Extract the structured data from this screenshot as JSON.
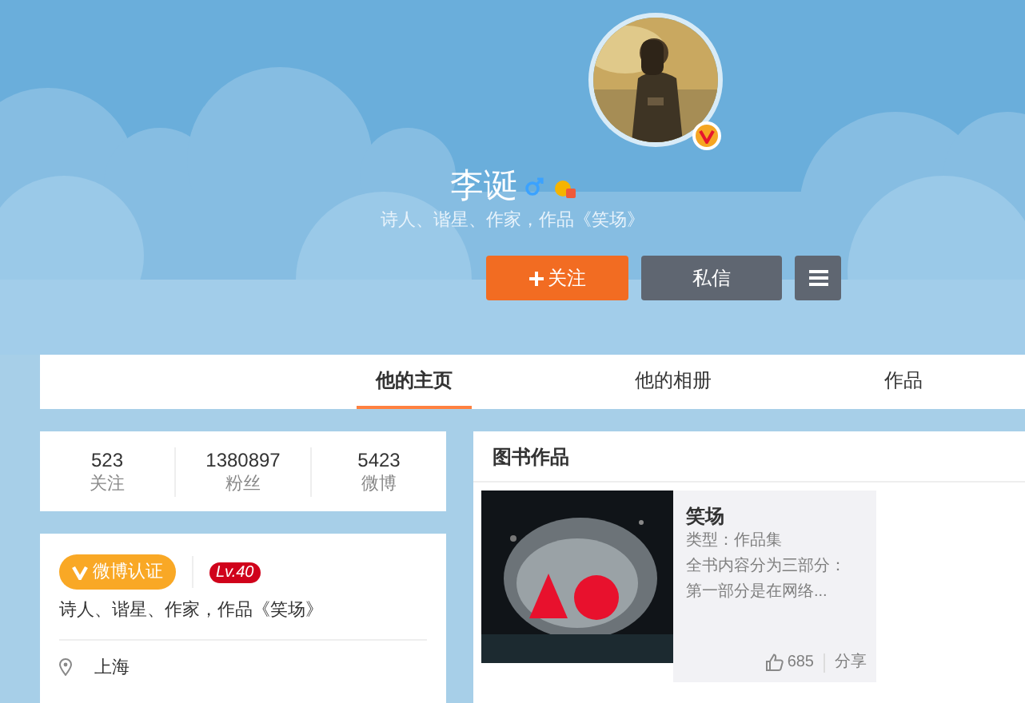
{
  "profile": {
    "name": "李诞",
    "bio": "诗人、谐星、作家，作品《笑场》",
    "verified": true
  },
  "actions": [
    {
      "kind": "follow",
      "label": "关注"
    },
    {
      "kind": "message",
      "label": "私信"
    },
    {
      "kind": "menu"
    }
  ],
  "tabs": [
    {
      "label": "他的主页",
      "selected": true
    },
    {
      "label": "他的相册",
      "selected": false
    },
    {
      "label": "作品",
      "selected": false
    }
  ],
  "stats": [
    {
      "value": "523",
      "label": "关注"
    },
    {
      "value": "1380897",
      "label": "粉丝"
    },
    {
      "value": "5423",
      "label": "微博"
    }
  ],
  "info": {
    "badge": "微博认证",
    "level": "Lv.40",
    "bio": "诗人、谐星、作家，作品《笑场》",
    "location": "上海"
  },
  "books_section": {
    "title": "图书作品",
    "books": [
      {
        "title": "笑场",
        "type": "类型：作品集",
        "summary": [
          "全书内容分为三部分：",
          "第一部分是在网络..."
        ],
        "likes": "685",
        "share": "分享"
      }
    ]
  }
}
